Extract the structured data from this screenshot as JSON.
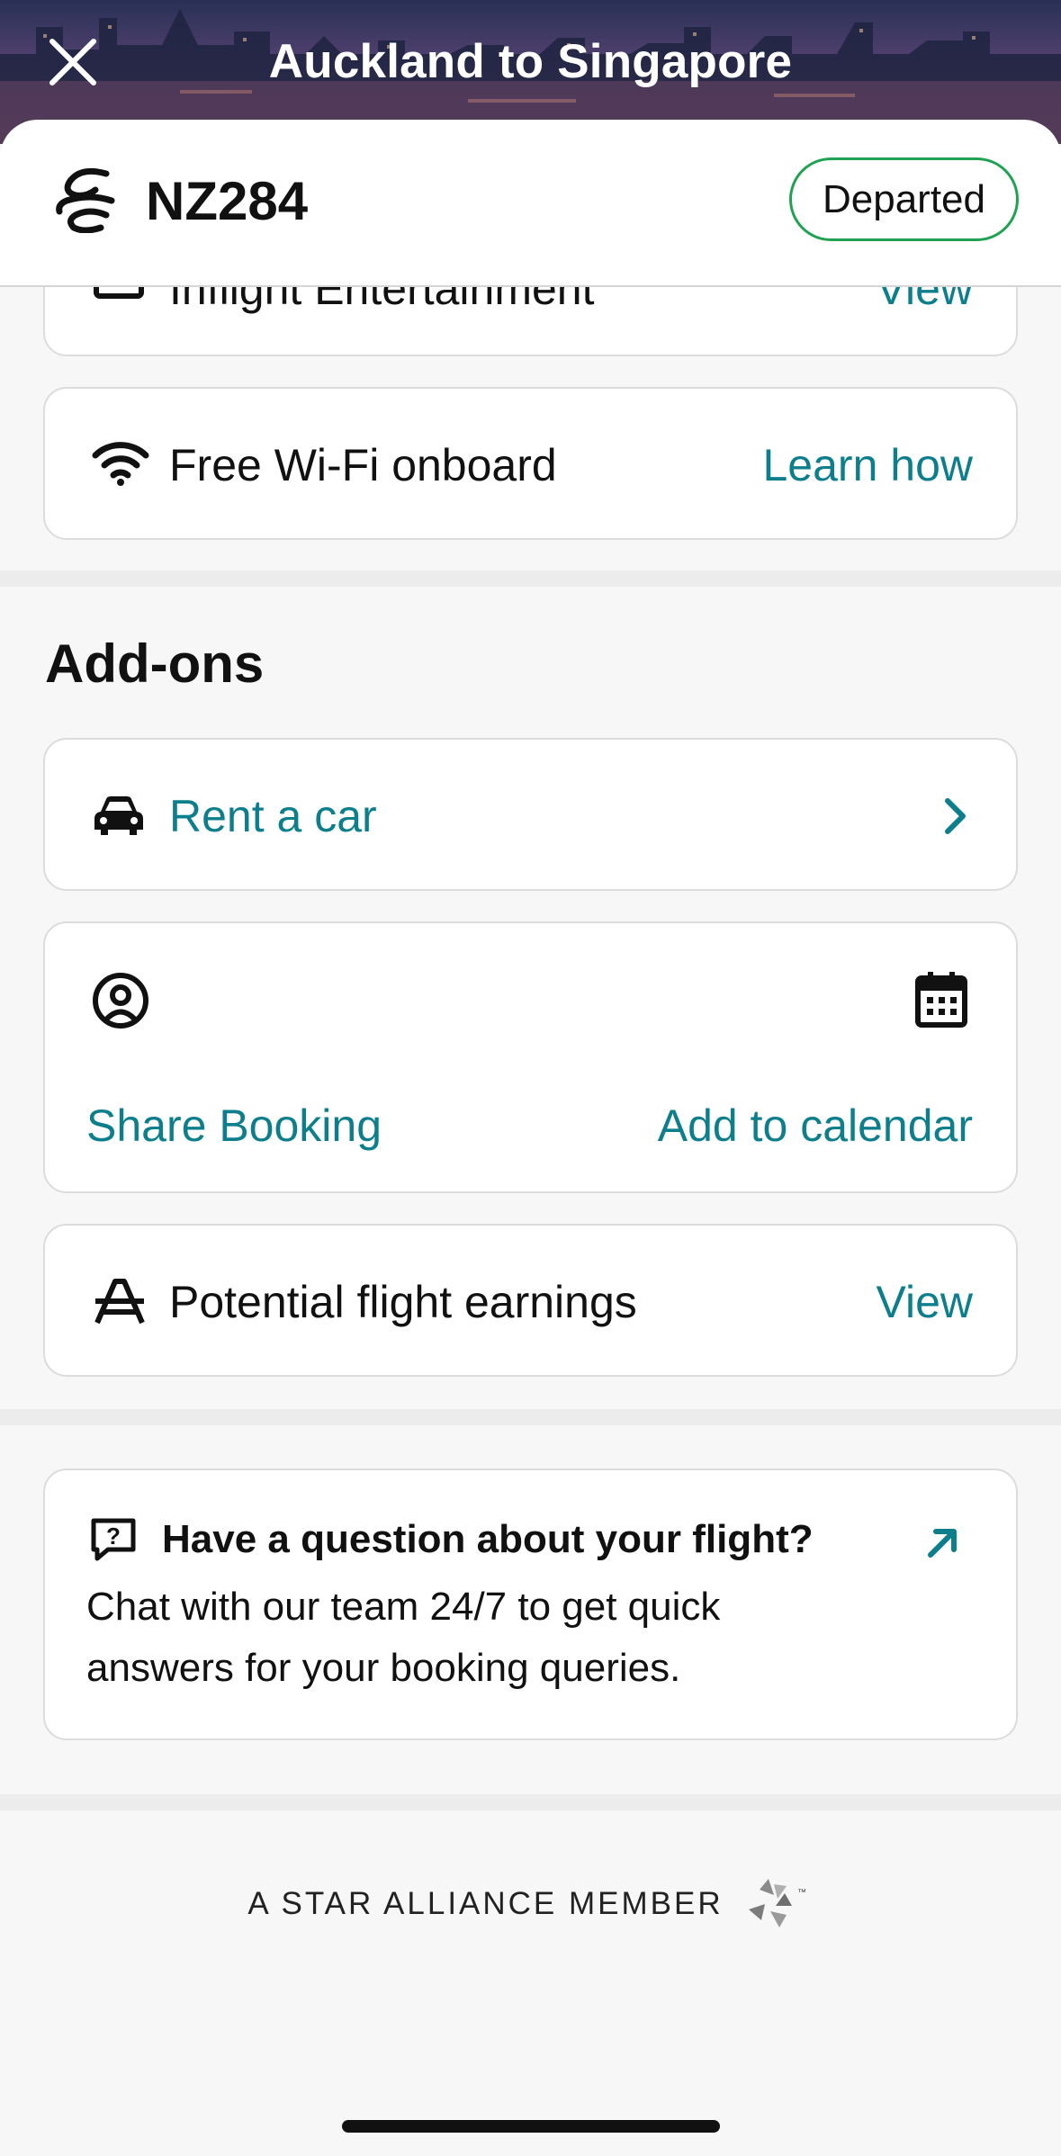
{
  "header": {
    "title": "Auckland to Singapore"
  },
  "flight": {
    "number": "NZ284",
    "status": "Departed",
    "status_color": "#1fa352"
  },
  "services": {
    "entertainment_label": "Inflight Entertainment",
    "entertainment_link": "View",
    "wifi_label": "Free Wi-Fi onboard",
    "wifi_link": "Learn how"
  },
  "addons": {
    "title": "Add-ons",
    "rent_car_label": "Rent a car",
    "share_booking_label": "Share Booking",
    "add_calendar_label": "Add to calendar",
    "earnings_label": "Potential flight earnings",
    "earnings_link": "View"
  },
  "question": {
    "title": "Have a question about your flight?",
    "body": "Chat with our team 24/7 to get quick answers for your booking queries."
  },
  "footer": {
    "alliance_text": "A STAR ALLIANCE MEMBER",
    "alliance_tm": "™"
  },
  "colors": {
    "accent": "#0d7f8c",
    "badge_border": "#1fa352"
  }
}
